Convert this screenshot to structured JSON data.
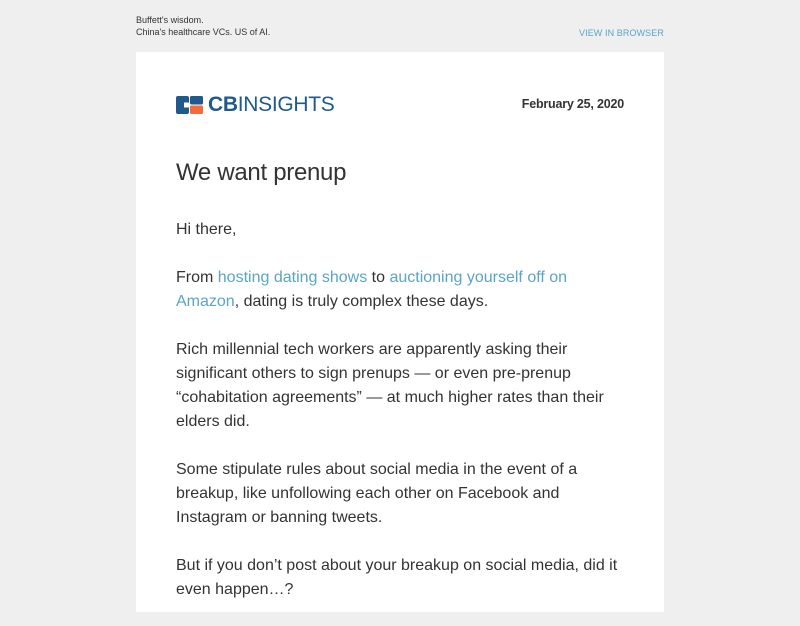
{
  "preheader": {
    "line1": "Buffett's wisdom.",
    "line2": "China's healthcare VCs. US of AI.",
    "view_in_browser": "VIEW IN BROWSER"
  },
  "header": {
    "logo_cb": "CB",
    "logo_insights": "INSIGHTS",
    "date": "February 25, 2020"
  },
  "article": {
    "title": "We want prenup",
    "greeting": "Hi there,",
    "p1": {
      "part1": "From ",
      "link1": "hosting dating shows",
      "part2": " to ",
      "link2": "auctioning yourself off on Amazon",
      "part3": ", dating is truly complex these days."
    },
    "p2": "Rich millennial tech workers are apparently asking their significant others to sign prenups — or even pre-prenup “cohabitation agreements” — at much higher rates than their elders did.",
    "p3": "Some stipulate rules about social media in the event of a breakup, like unfollowing each other on Facebook and Instagram or banning tweets.",
    "p4": "But if you don’t post about your breakup on social media, did it even happen…?"
  },
  "colors": {
    "background": "#efefef",
    "card": "#ffffff",
    "link": "#5aa4c8",
    "brand_blue": "#1f5a8c",
    "brand_orange": "#f26b3a",
    "text": "#333333"
  }
}
